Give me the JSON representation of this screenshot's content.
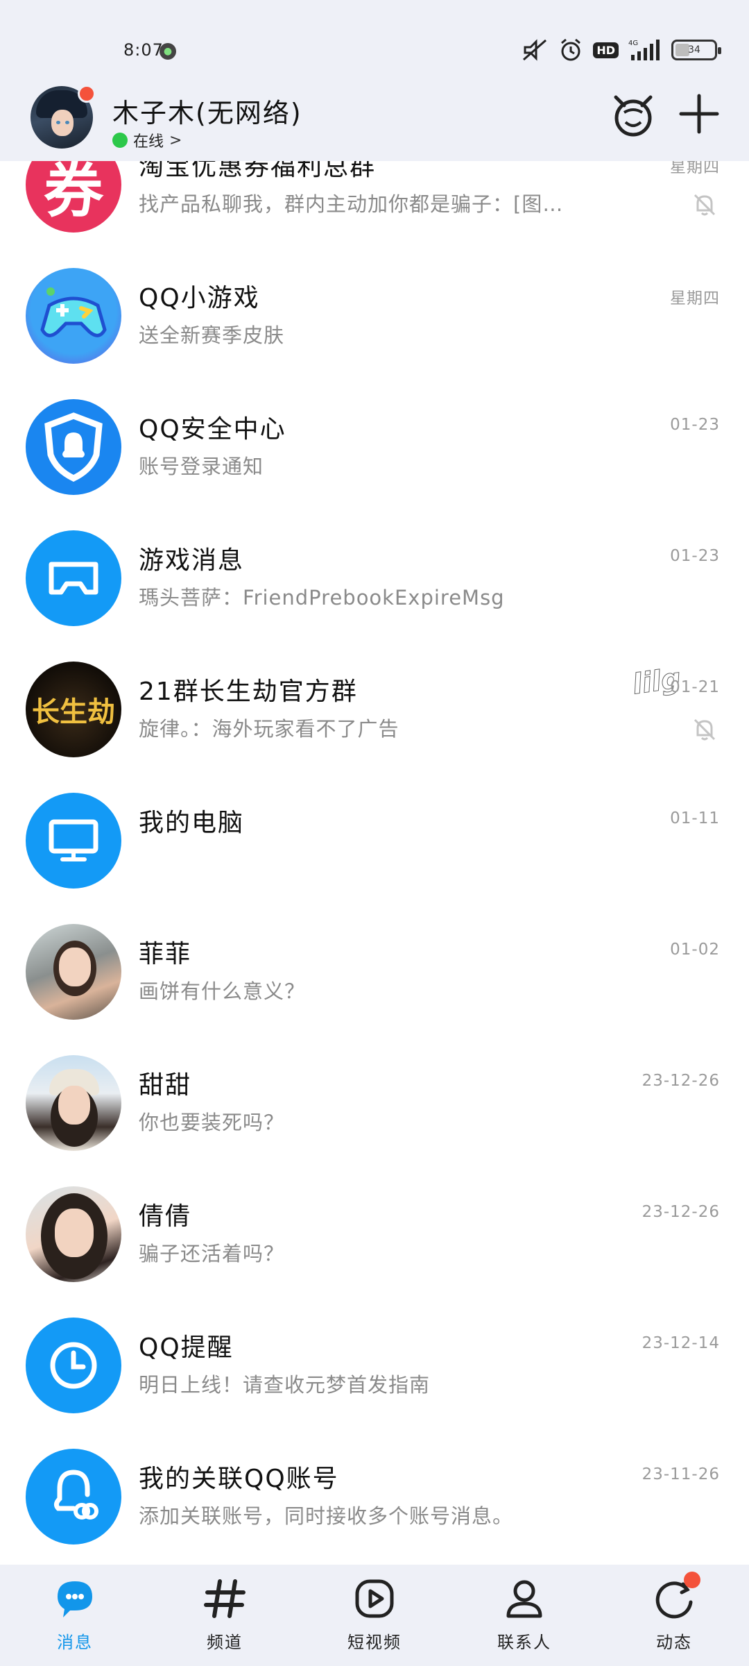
{
  "status_bar": {
    "time": "8:07",
    "network": "4G",
    "hd": "HD",
    "battery": "34"
  },
  "header": {
    "username": "木子木(无网络)",
    "presence": "在线",
    "presence_chevron": ">"
  },
  "chats": [
    {
      "title": "淘宝优惠券福利总群",
      "preview": "找产品私聊我，群内主动加你都是骗子：[图…",
      "time": "星期四",
      "muted": true,
      "avatar_text": "券"
    },
    {
      "title": "QQ小游戏",
      "preview": "送全新赛季皮肤",
      "time": "星期四"
    },
    {
      "title": "QQ安全中心",
      "preview": "账号登录通知",
      "time": "01-23"
    },
    {
      "title": "游戏消息",
      "preview": "瑪头菩萨：FriendPrebookExpireMsg",
      "time": "01-23"
    },
    {
      "title": "21群长生劫官方群",
      "preview": "旋律。：海外玩家看不了广告",
      "time": "01-21",
      "muted": true,
      "tag": "lilg",
      "avatar_text": "长生劫"
    },
    {
      "title": "我的电脑",
      "preview": "",
      "time": "01-11"
    },
    {
      "title": "菲菲",
      "preview": "画饼有什么意义？",
      "time": "01-02"
    },
    {
      "title": "甜甜",
      "preview": "你也要装死吗？",
      "time": "23-12-26"
    },
    {
      "title": "倩倩",
      "preview": "骗子还活着吗？",
      "time": "23-12-26"
    },
    {
      "title": "QQ提醒",
      "preview": "明日上线！请查收元梦首发指南",
      "time": "23-12-14"
    },
    {
      "title": "我的关联QQ账号",
      "preview": "添加关联账号，同时接收多个账号消息。",
      "time": "23-11-26"
    }
  ],
  "nav": {
    "messages": "消息",
    "channels": "频道",
    "short_video": "短视频",
    "contacts": "联系人",
    "moments": "动态"
  },
  "colors": {
    "accent": "#1296ea",
    "badge": "#f4523b",
    "header_bg": "#eef0f7",
    "online": "#2cc84a"
  }
}
